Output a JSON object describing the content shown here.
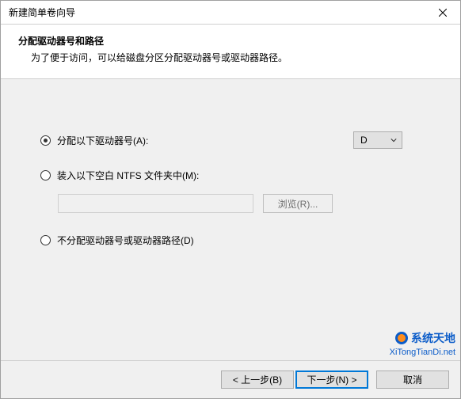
{
  "titlebar": {
    "title": "新建简单卷向导"
  },
  "header": {
    "title": "分配驱动器号和路径",
    "desc": "为了便于访问，可以给磁盘分区分配驱动器号或驱动器路径。"
  },
  "options": {
    "assign": "分配以下驱动器号(A):",
    "mount": "装入以下空白 NTFS 文件夹中(M):",
    "none": "不分配驱动器号或驱动器路径(D)"
  },
  "drive": {
    "selected": "D"
  },
  "mountPath": "",
  "buttons": {
    "browse": "浏览(R)...",
    "back": "< 上一步(B)",
    "next": "下一步(N) >",
    "cancel": "取消"
  },
  "watermark": {
    "brand": "系统天地",
    "url": "XiTongTianDi.net"
  }
}
